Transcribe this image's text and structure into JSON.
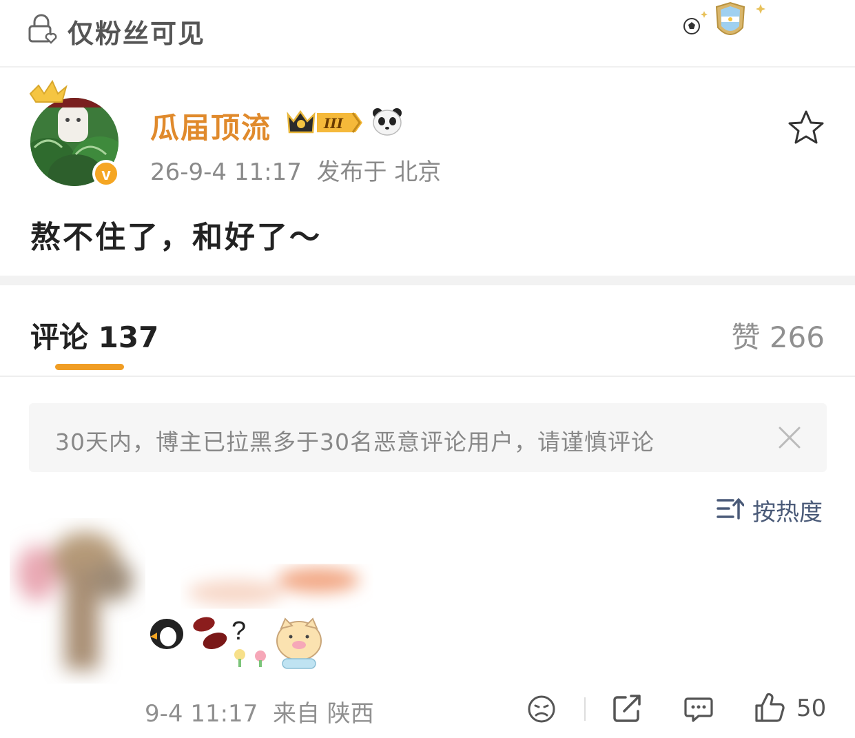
{
  "top": {
    "visibility_label": "仅粉丝可见"
  },
  "post": {
    "author": "瓜届顶流",
    "level": "III",
    "date": "26-9-4 11:17",
    "location_label": "发布于 北京",
    "text": "熬不住了，和好了～"
  },
  "tabs": {
    "comments_label": "评论 137",
    "likes_label": "赞 266"
  },
  "notice": {
    "text": "30天内，博主已拉黑多于30名恶意评论用户，请谨慎评论"
  },
  "sort": {
    "label": "按热度"
  },
  "comment": {
    "emoji_question": "?",
    "date": "9-4 11:17",
    "source": "来自 陕西",
    "like_count": "50"
  },
  "colors": {
    "accent": "#f09d24",
    "username": "#e08a2c",
    "sort_blue": "#4a5a78",
    "verified": "#f5a623"
  }
}
